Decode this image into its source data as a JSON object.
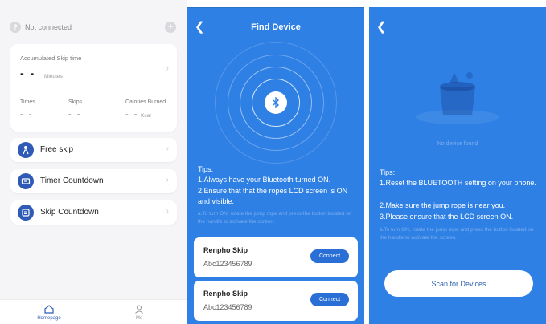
{
  "colors": {
    "accent": "#2f5bb7",
    "screen_blue": "#2f80e5",
    "button_blue": "#2a6fd6"
  },
  "home": {
    "status": "Not connected",
    "status_icon": "question-icon",
    "skip_card": {
      "title": "Accumulated Skip time",
      "value": "- -",
      "unit": "Minutes"
    },
    "stats": [
      {
        "label": "Times",
        "value": "- -"
      },
      {
        "label": "Skips",
        "value": "- -"
      },
      {
        "label": "Calories Burned",
        "value": "- -",
        "unit": "Kcal"
      }
    ],
    "menu": [
      {
        "label": "Free skip",
        "icon": "skipper-icon"
      },
      {
        "label": "Timer Countdown",
        "icon": "timer-icon"
      },
      {
        "label": "Skip Countdown",
        "icon": "counter-icon"
      }
    ],
    "tabs": [
      {
        "label": "Homepage",
        "icon": "home-icon"
      },
      {
        "label": "Me",
        "icon": "user-icon"
      }
    ]
  },
  "find": {
    "title": "Find Device",
    "tips_heading": "Tips:",
    "tips": [
      "1.Always have your Bluetooth turned ON.",
      "2.Ensure that that the ropes LCD screen is ON and visible."
    ],
    "faint": "a.To turn ON, rotate the jump rope and press the button located on the handle to activate the screen.",
    "devices": [
      {
        "name": "Renpho Skip",
        "id": "Abc123456789",
        "button": "Connect"
      },
      {
        "name": "Renpho Skip",
        "id": "Abc123456789",
        "button": "Connect"
      }
    ]
  },
  "notfound": {
    "message": "No device found",
    "tips_heading": "Tips:",
    "tips": [
      "1.Reset the BLUETOOTH setting on your phone.",
      "2.Make sure the jump rope is near you.",
      "3.Please ensure that the LCD screen ON."
    ],
    "faint": "a.To turn ON, rotate the jump rope and press the button located on the handle to activate the screen.",
    "scan_button": "Scan for Devices"
  }
}
